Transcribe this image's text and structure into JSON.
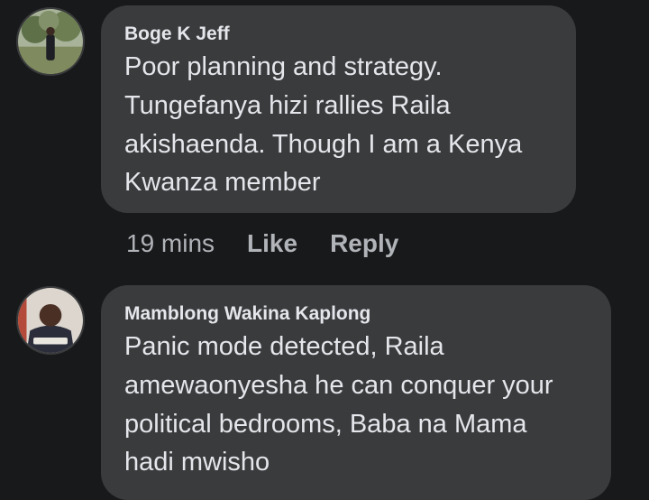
{
  "comments": [
    {
      "author": "Boge K Jeff",
      "lines": [
        "Poor planning and strategy.",
        "Tungefanya hizi rallies Raila",
        "akishaenda. Though I am a Kenya",
        "Kwanza member"
      ],
      "time": "19 mins",
      "like_label": "Like",
      "reply_label": "Reply"
    },
    {
      "author": "Mamblong Wakina Kaplong",
      "lines": [
        "Panic mode detected, Raila",
        "amewaonyesha he can conquer your",
        "political bedrooms, Baba na Mama",
        "hadi mwisho"
      ]
    }
  ],
  "colors": {
    "background": "#18191a",
    "bubble": "#3a3b3c",
    "text_primary": "#e4e6eb",
    "text_secondary": "#b0b3b8"
  }
}
